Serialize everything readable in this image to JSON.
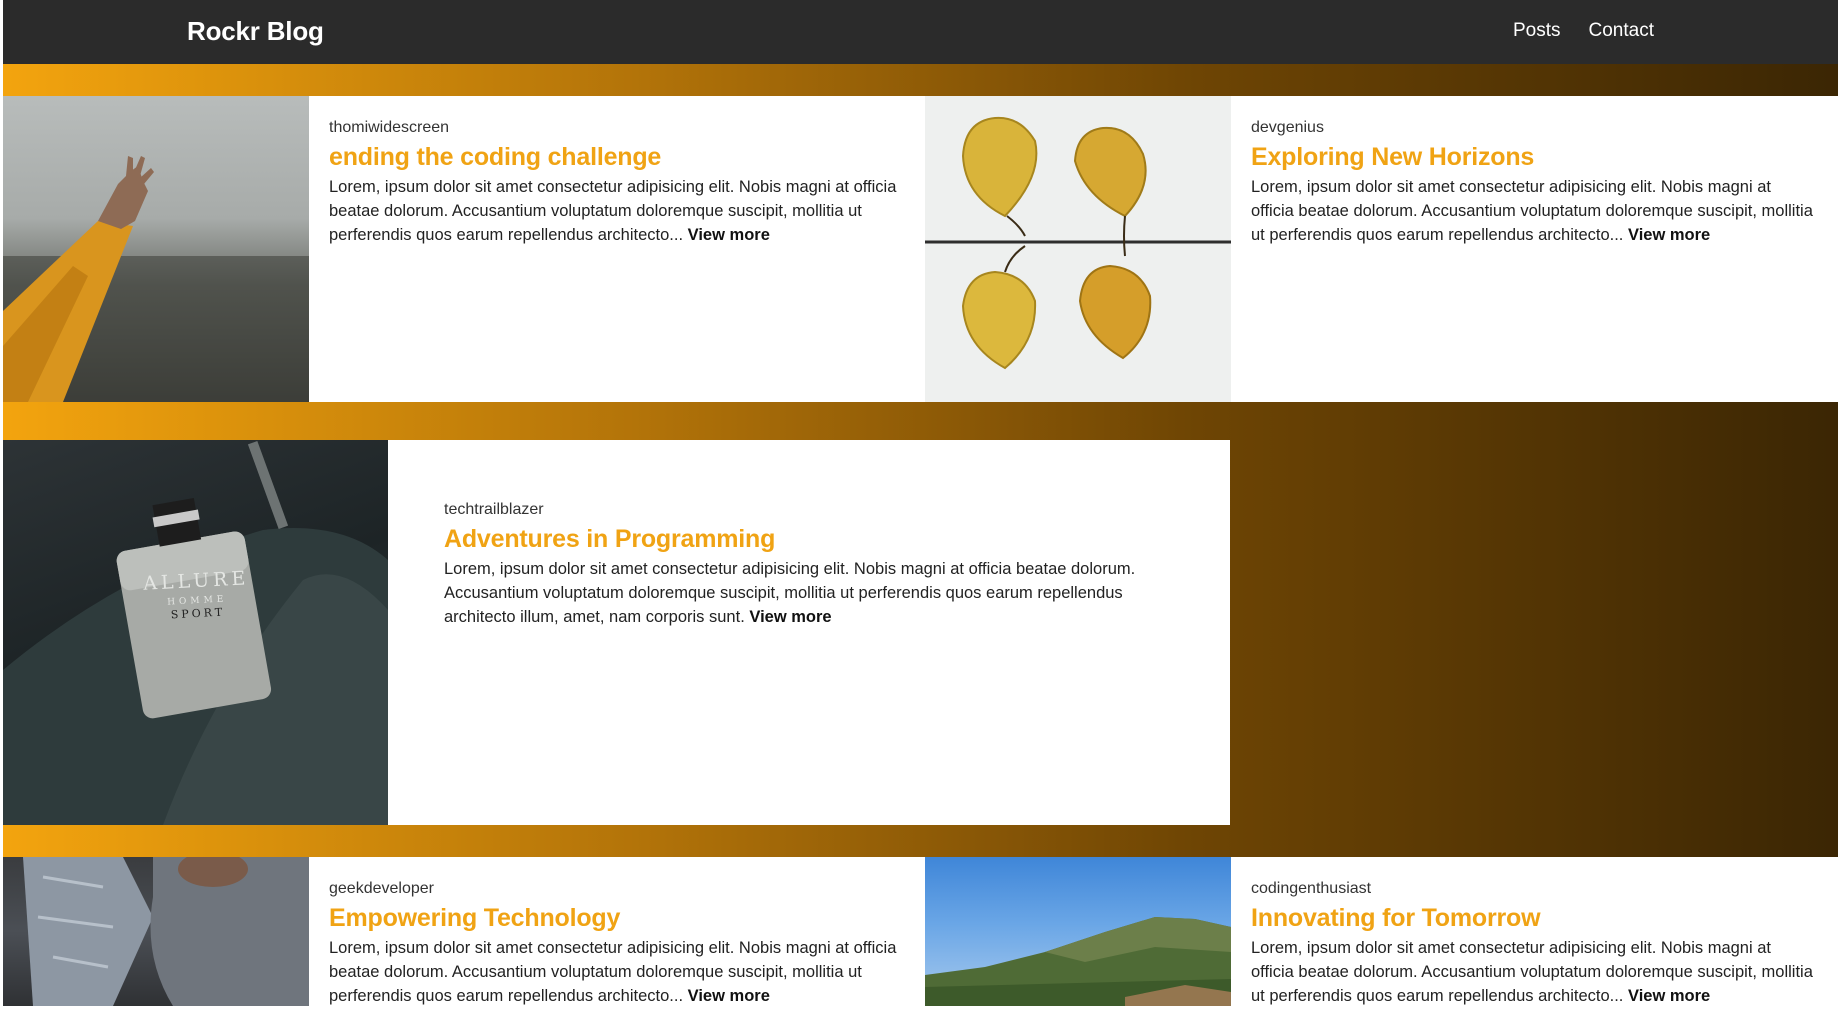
{
  "navbar": {
    "brand": "Rockr Blog",
    "links": [
      "Posts",
      "Contact"
    ]
  },
  "colors": {
    "accent": "#f0a314",
    "navbar_bg": "#2b2b2b",
    "gradient_start": "#f3a40e",
    "gradient_end": "#3b2604"
  },
  "posts": [
    {
      "author": "thomiwidescreen",
      "title": "ending the coding challenge",
      "excerpt": "Lorem, ipsum dolor sit amet consectetur adipisicing elit. Nobis magni at officia beatae dolorum. Accusantium voluptatum doloremque suscipit, mollitia ut perferendis quos earum repellendus architecto...",
      "view_more": "View more",
      "image": "arm-reaching-sky-photo"
    },
    {
      "author": "devgenius",
      "title": "Exploring New Horizons",
      "excerpt": "Lorem, ipsum dolor sit amet consectetur adipisicing elit. Nobis magni at officia beatae dolorum. Accusantium voluptatum doloremque suscipit, mollitia ut perferendis quos earum repellendus architecto...",
      "view_more": "View more",
      "image": "yellow-leaves-photo"
    },
    {
      "author": "techtrailblazer",
      "title": "Adventures in Programming",
      "excerpt": "Lorem, ipsum dolor sit amet consectetur adipisicing elit. Nobis magni at officia beatae dolorum. Accusantium voluptatum doloremque suscipit, mollitia ut perferendis quos earum repellendus architecto illum, amet, nam corporis sunt.",
      "view_more": "View more",
      "image": "perfume-bottle-photo",
      "bottle_label": [
        "ALLURE",
        "HOMME",
        "SPORT"
      ]
    },
    {
      "author": "geekdeveloper",
      "title": "Empowering Technology",
      "excerpt": "Lorem, ipsum dolor sit amet consectetur adipisicing elit. Nobis magni at officia beatae dolorum. Accusantium voluptatum doloremque suscipit, mollitia ut perferendis quos earum repellendus architecto...",
      "view_more": "View more",
      "image": "person-jeans-photo"
    },
    {
      "author": "codingenthusiast",
      "title": "Innovating for Tomorrow",
      "excerpt": "Lorem, ipsum dolor sit amet consectetur adipisicing elit. Nobis magni at officia beatae dolorum. Accusantium voluptatum doloremque suscipit, mollitia ut perferendis quos earum repellendus architecto...",
      "view_more": "View more",
      "image": "green-hills-photo"
    }
  ]
}
